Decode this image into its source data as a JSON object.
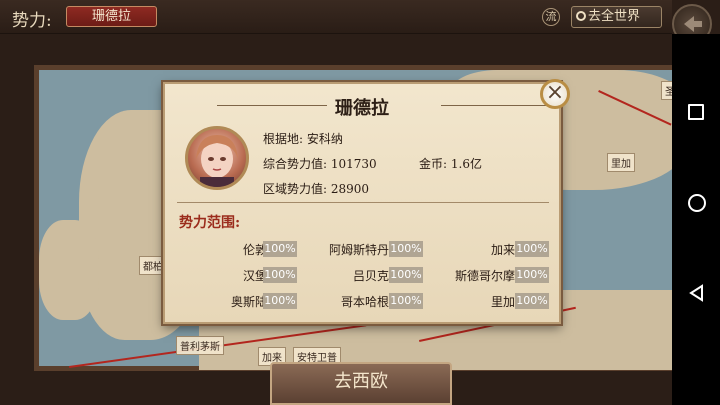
{
  "topbar": {
    "faction_label": "势力:",
    "faction_value": "珊德拉",
    "flow_label": "流",
    "world_button": "去全世界"
  },
  "map": {
    "labels": [
      "都柏",
      "普利茅斯",
      "加来",
      "安特卫普",
      "里加",
      "圣"
    ]
  },
  "bottom_tab": {
    "label": "去西欧"
  },
  "popup": {
    "title": "珊德拉",
    "base_label": "根据地:",
    "base_value": "安科纳",
    "total_power_label": "综合势力值:",
    "total_power_value": "101730",
    "gold_label": "金币:",
    "gold_value": "1.6亿",
    "region_power_label": "区域势力值:",
    "region_power_value": "28900",
    "scope_title": "势力范围:",
    "territories": [
      {
        "name": "伦敦",
        "percent": "100%"
      },
      {
        "name": "阿姆斯特丹",
        "percent": "100%"
      },
      {
        "name": "加来",
        "percent": "100%"
      },
      {
        "name": "汉堡",
        "percent": "100%"
      },
      {
        "name": "吕贝克",
        "percent": "100%"
      },
      {
        "name": "斯德哥尔摩",
        "percent": "100%"
      },
      {
        "name": "奥斯陆",
        "percent": "100%"
      },
      {
        "name": "哥本哈根",
        "percent": "100%"
      },
      {
        "name": "里加",
        "percent": "100%"
      }
    ]
  },
  "colors": {
    "accent_red": "#9b2c1c",
    "panel_bg": "#f2e6cd"
  }
}
